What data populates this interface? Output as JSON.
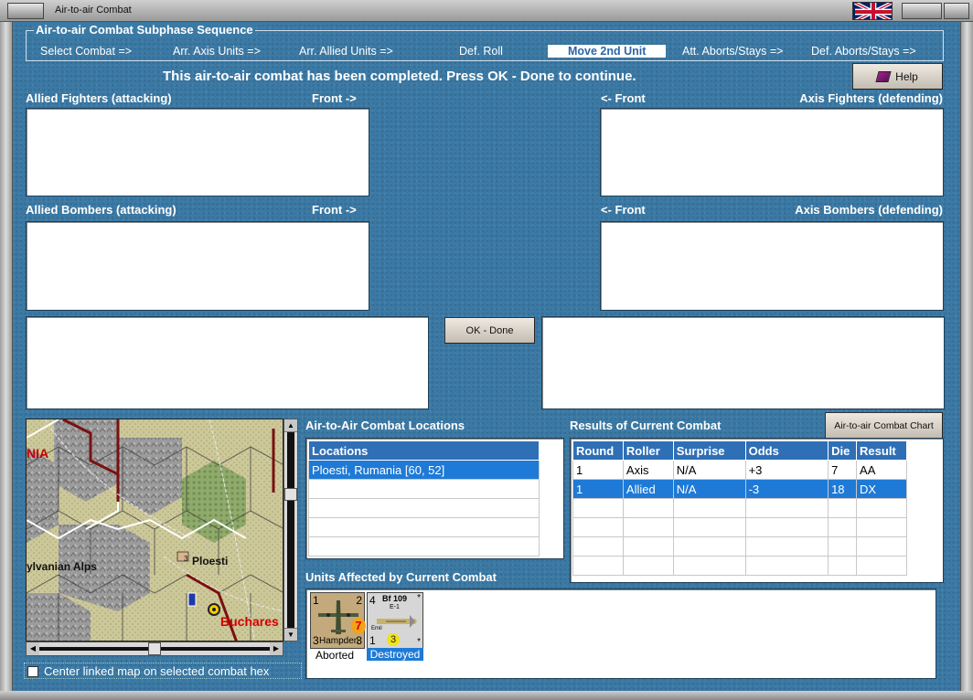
{
  "window": {
    "title": "Air-to-air Combat"
  },
  "subphase": {
    "heading": "Air-to-air Combat Subphase Sequence",
    "steps": [
      "Select Combat =>",
      "Arr. Axis Units =>",
      "Arr. Allied Units =>",
      "Def. Roll",
      "Move 2nd Unit",
      "Att. Aborts/Stays =>",
      "Def. Aborts/Stays =>"
    ],
    "active_index": 4
  },
  "status_message": "This air-to-air combat has been completed.  Press OK - Done to continue.",
  "help_label": "Help",
  "allied_fighters": {
    "label": "Allied Fighters (attacking)",
    "front": "Front ->"
  },
  "axis_fighters": {
    "label": "Axis Fighters (defending)",
    "front": "<- Front"
  },
  "allied_bombers": {
    "label": "Allied Bombers (attacking)",
    "front": "Front ->"
  },
  "axis_bombers": {
    "label": "Axis Bombers (defending)",
    "front": "<- Front"
  },
  "ok_done_label": "OK - Done",
  "map": {
    "labels": {
      "region": "NIA",
      "mountains": "ylvanian Alps",
      "city1": "Ploesti",
      "city2": "Buchares",
      "marker": "3"
    },
    "center_checkbox_label": "Center linked map on selected combat hex",
    "center_checked": false
  },
  "locations": {
    "heading": "Air-to-Air Combat Locations",
    "column": "Locations",
    "rows": [
      "Ploesti, Rumania [60, 52]",
      "",
      "",
      "",
      ""
    ],
    "selected_index": 0
  },
  "results": {
    "heading": "Results of Current Combat",
    "chart_button": "Air-to-air Combat Chart",
    "columns": [
      "Round",
      "Roller",
      "Surprise",
      "Odds",
      "Die",
      "Result"
    ],
    "rows": [
      [
        "1",
        "Axis",
        "N/A",
        "+3",
        "7",
        "AA"
      ],
      [
        "1",
        "Allied",
        "N/A",
        "-3",
        "18",
        "DX"
      ],
      [
        "",
        "",
        "",
        "",
        "",
        ""
      ],
      [
        "",
        "",
        "",
        "",
        "",
        ""
      ],
      [
        "",
        "",
        "",
        "",
        "",
        ""
      ],
      [
        "",
        "",
        "",
        "",
        "",
        ""
      ]
    ],
    "selected_index": 1
  },
  "affected": {
    "heading": "Units Affected by Current Combat",
    "units": [
      {
        "name": "Hampden",
        "top_left": "1",
        "top_right": "2",
        "bottom_left": "3",
        "bottom_right": "3",
        "badge": "7",
        "badge_color": "#f4a21b",
        "status": "Aborted",
        "selected": false
      },
      {
        "name": "Bf 109",
        "sub": "E-1",
        "nick": "Emil",
        "top_left": "4",
        "top_right": "*",
        "bottom_left": "1",
        "bottom_right": "*",
        "badge": "3",
        "badge_color": "#f2e21a",
        "status": "Destroyed",
        "selected": true
      }
    ]
  }
}
